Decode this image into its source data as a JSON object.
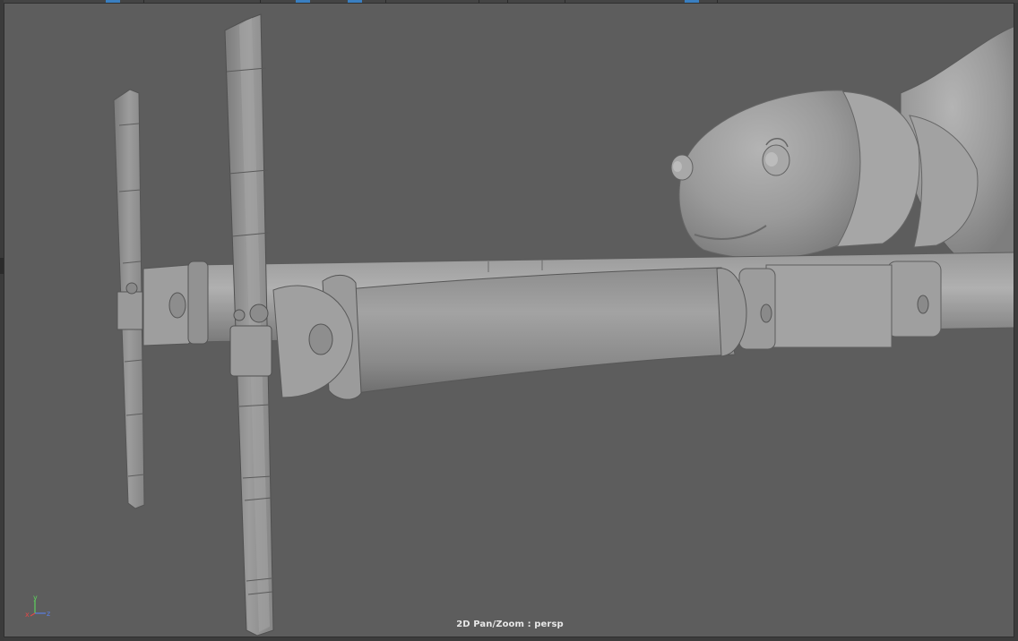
{
  "viewport": {
    "hud_label": "2D Pan/Zoom : persp",
    "camera": "persp",
    "background_color": "#5d5d5d"
  },
  "axis_gizmo": {
    "x_label": "x",
    "y_label": "y",
    "z_label": "z",
    "x_color": "#e04848",
    "y_color": "#5ed25e",
    "z_color": "#5a7fe6"
  },
  "icons": {
    "axis": "axis-gizmo-icon"
  }
}
